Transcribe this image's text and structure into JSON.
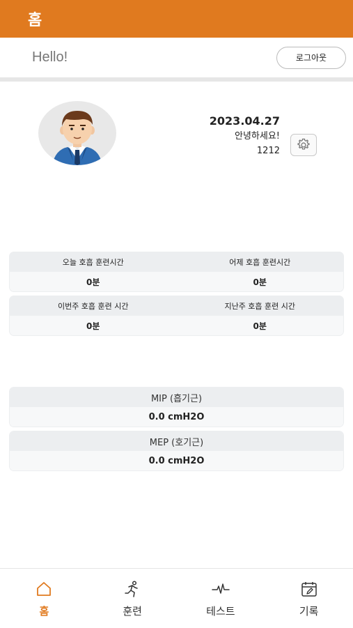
{
  "appbar": {
    "title": "홈"
  },
  "header": {
    "greeting": "Hello!",
    "logout_label": "로그아웃"
  },
  "profile": {
    "avatar": "man-avatar-icon",
    "date": "2023.04.27",
    "greeting": "안녕하세요!",
    "user_id": "1212",
    "settings_icon": "gear-icon"
  },
  "stats": [
    {
      "left_label": "오늘 호흡 훈련시간",
      "right_label": "어제 호흡 훈련시간",
      "left_value": "0분",
      "right_value": "0분"
    },
    {
      "left_label": "이번주 호흡 훈련 시간",
      "right_label": "지난주 호흡 훈련 시간",
      "left_value": "0분",
      "right_value": "0분"
    }
  ],
  "measurements": [
    {
      "label": "MIP (흡기근)",
      "value": "0.0 cmH2O"
    },
    {
      "label": "MEP (호기근)",
      "value": "0.0 cmH2O"
    }
  ],
  "nav": {
    "items": [
      {
        "label": "홈",
        "icon": "home-icon",
        "active": true
      },
      {
        "label": "훈련",
        "icon": "running-icon",
        "active": false
      },
      {
        "label": "테스트",
        "icon": "pulse-icon",
        "active": false
      },
      {
        "label": "기록",
        "icon": "calendar-edit-icon",
        "active": false
      }
    ]
  },
  "colors": {
    "accent": "#e07a1f",
    "card_header": "#eceef0",
    "card_body": "#f7f8f9"
  }
}
